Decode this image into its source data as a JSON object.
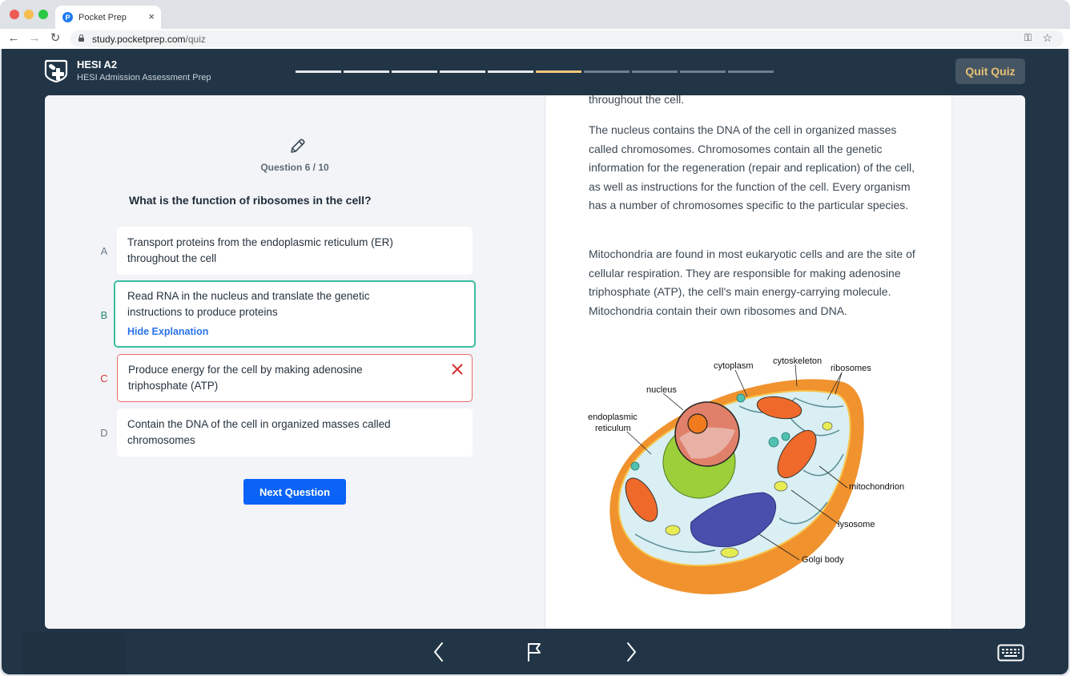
{
  "browser": {
    "tab_title": "Pocket Prep",
    "tab_favicon": "P",
    "close_tab_icon": "×",
    "back_icon": "←",
    "forward_icon": "→",
    "reload_icon": "↻",
    "url_domain": "study.pocketprep.com",
    "url_path": "/quiz",
    "key_icon": "⚿",
    "star_icon": "☆"
  },
  "header": {
    "title": "HESI A2",
    "subtitle": "HESI Admission Assessment Prep",
    "quit_label": "Quit Quiz",
    "progress": {
      "total": 10,
      "current": 6,
      "completed": 5
    },
    "colors": {
      "done": "#e4e8eb",
      "current": "#f2c879",
      "upcoming": "#6f7f8c",
      "quit_text": "#e7c276"
    }
  },
  "question": {
    "counter": "Question 6 / 10",
    "text": "What is the function of ribosomes in the cell?",
    "options": [
      {
        "letter": "A",
        "text": "Transport proteins from the endoplasmic reticulum (ER) throughout the cell",
        "state": "neutral"
      },
      {
        "letter": "B",
        "text": "Read RNA in the nucleus and translate the genetic instructions to produce proteins",
        "state": "correct",
        "link": "Hide Explanation"
      },
      {
        "letter": "C",
        "text": "Produce energy for the cell by making adenosine triphosphate (ATP)",
        "state": "wrong"
      },
      {
        "letter": "D",
        "text": "Contain the DNA of the cell in organized masses called chromosomes",
        "state": "neutral"
      }
    ],
    "next_label": "Next Question",
    "colors": {
      "correct": "#3bbea2",
      "wrong": "#e86d6d",
      "primary": "#0a63f6",
      "link": "#2a73e8"
    }
  },
  "explanation": {
    "paragraphs": [
      "throughout the cell.",
      "The nucleus contains the DNA of the cell in organized masses called chromosomes. Chromosomes contain all the genetic information for the regeneration (repair and replication) of the cell, as well as instructions for the function of the cell. Every organism has a number of chromosomes specific to the particular species.",
      "Mitochondria are found in most eukaryotic cells and are the site of cellular respiration. They are responsible for making adenosine triphosphate (ATP), the cell's main energy-carrying molecule. Mitochondria contain their own ribosomes and DNA."
    ],
    "figure_labels": {
      "cytoplasm": "cytoplasm",
      "cytoskeleton": "cytoskeleton",
      "ribosomes": "ribosomes",
      "nucleus": "nucleus",
      "er_line1": "endoplasmic",
      "er_line2": "reticulum",
      "mitochondrion": "mitochondrion",
      "lysosome": "lysosome",
      "golgi": "Golgi body"
    }
  },
  "footer": {
    "prev_icon": "chevron-left",
    "flag_icon": "flag",
    "next_icon": "chevron-right",
    "keyboard_icon": "keyboard"
  }
}
